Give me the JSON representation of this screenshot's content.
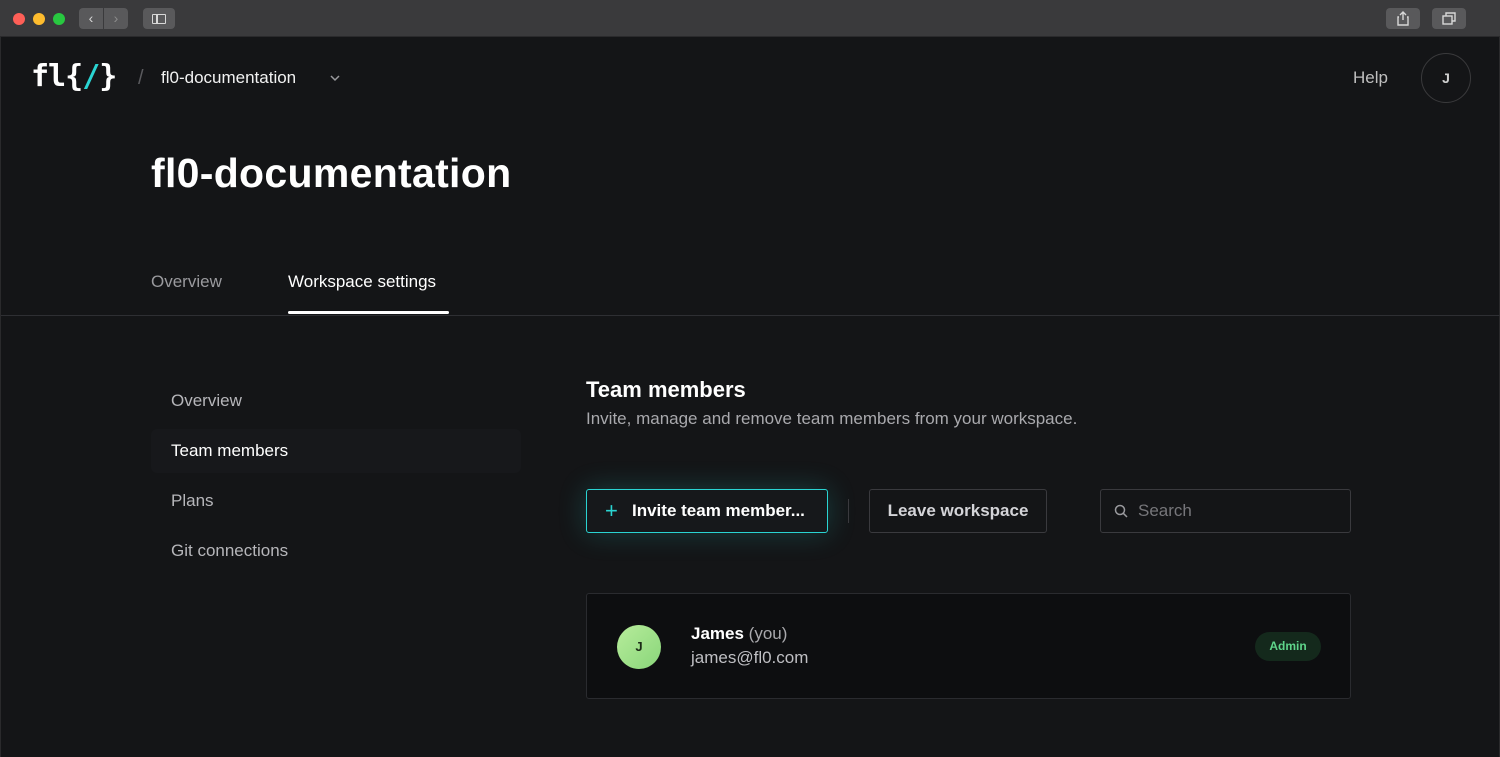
{
  "browser": {
    "back_glyph": "‹",
    "forward_glyph": "›"
  },
  "header": {
    "logo_prefix": "fl{",
    "logo_slash": "/",
    "logo_suffix": "}",
    "separator": "/",
    "workspace_name": "fl0-documentation",
    "help_label": "Help",
    "avatar_initial": "J"
  },
  "page": {
    "title": "fl0-documentation"
  },
  "tabs": [
    {
      "label": "Overview"
    },
    {
      "label": "Workspace settings"
    }
  ],
  "sidebar": {
    "items": [
      {
        "label": "Overview"
      },
      {
        "label": "Team members"
      },
      {
        "label": "Plans"
      },
      {
        "label": "Git connections"
      }
    ]
  },
  "main": {
    "title": "Team members",
    "subtitle": "Invite, manage and remove team members from your workspace.",
    "invite_button": {
      "plus": "+",
      "label": "Invite team member..."
    },
    "leave_button": "Leave workspace",
    "search": {
      "placeholder": "Search"
    },
    "members": [
      {
        "initial": "J",
        "name": "James",
        "you": "(you)",
        "email": "james@fl0.com",
        "role": "Admin"
      }
    ]
  },
  "colors": {
    "accent": "#2ad4d2",
    "background": "#141517",
    "admin_badge_text": "#5fd58a"
  },
  "icons": [
    "chevron-down-icon",
    "search-icon",
    "share-icon",
    "tabs-icon",
    "sidebar-icon"
  ]
}
